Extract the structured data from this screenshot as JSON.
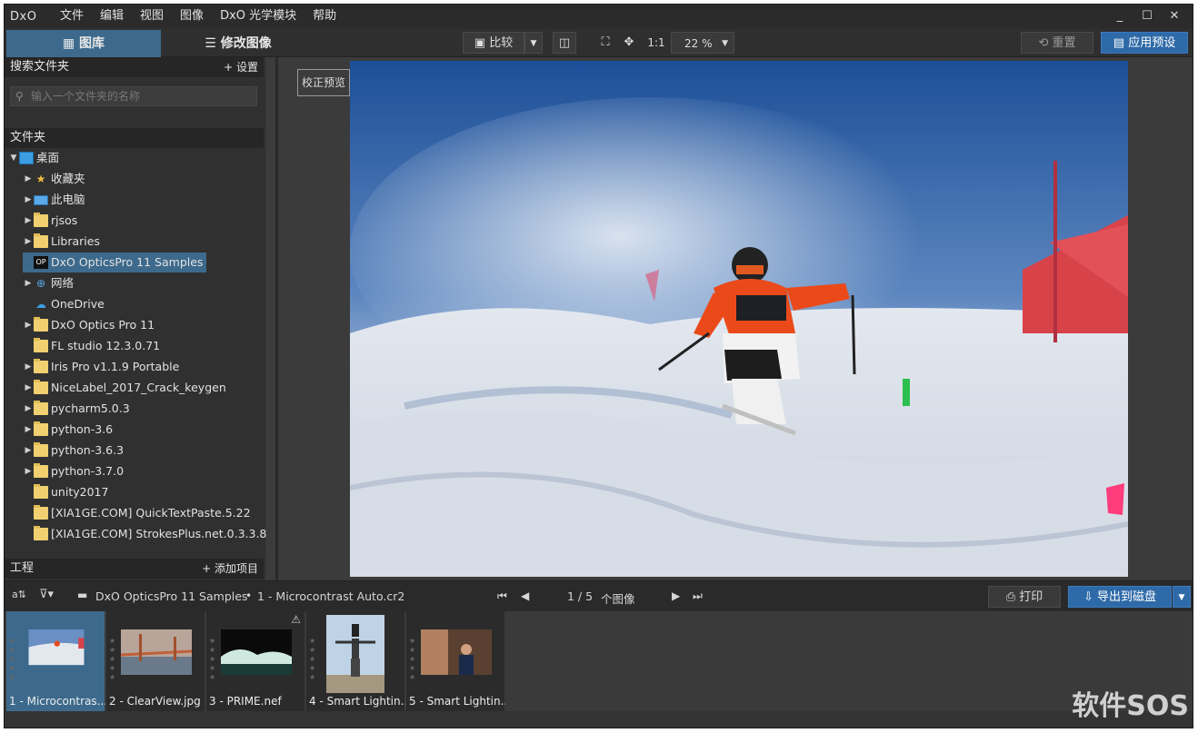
{
  "menubar": {
    "logo": "DxO",
    "items": [
      "文件",
      "编辑",
      "视图",
      "图像",
      "DxO 光学模块",
      "帮助"
    ],
    "minimize": "_",
    "maximize": "☐",
    "close": "✕"
  },
  "toolbar": {
    "tab_library": "图库",
    "tab_customize": "修改图像",
    "compare": "比较",
    "zoom_11": "1:1",
    "zoom_value": "22 %",
    "reset": "重置",
    "apply_preset": "应用预设"
  },
  "left": {
    "search_title": "搜索文件夹",
    "settings": "+ 设置",
    "search_placeholder": "输入一个文件夹的名称",
    "folders_title": "文件夹",
    "projects_title": "工程",
    "add_project": "+ 添加项目",
    "tree": [
      {
        "label": "桌面",
        "icon": "desktop-icon"
      },
      {
        "label": "收藏夹",
        "icon": "star-icon"
      },
      {
        "label": "此电脑",
        "icon": "pc-icon"
      },
      {
        "label": "rjsos",
        "icon": "folder-icon"
      },
      {
        "label": "Libraries",
        "icon": "folder-icon"
      },
      {
        "label": "DxO OpticsPro 11 Samples",
        "icon": "dxo-icon"
      },
      {
        "label": "网络",
        "icon": "network-icon"
      },
      {
        "label": "OneDrive",
        "icon": "cloud-icon"
      },
      {
        "label": "DxO Optics Pro 11",
        "icon": "folder-icon"
      },
      {
        "label": "FL studio 12.3.0.71",
        "icon": "folder-icon"
      },
      {
        "label": "Iris Pro v1.1.9 Portable",
        "icon": "folder-icon"
      },
      {
        "label": "NiceLabel_2017_Crack_keygen",
        "icon": "folder-icon"
      },
      {
        "label": "pycharm5.0.3",
        "icon": "folder-icon"
      },
      {
        "label": "python-3.6",
        "icon": "folder-icon"
      },
      {
        "label": "python-3.6.3",
        "icon": "folder-icon"
      },
      {
        "label": "python-3.7.0",
        "icon": "folder-icon"
      },
      {
        "label": "unity2017",
        "icon": "folder-icon"
      },
      {
        "label": "[XIA1GE.COM] QuickTextPaste.5.22",
        "icon": "folder-icon"
      },
      {
        "label": "[XIA1GE.COM] StrokesPlus.net.0.3.3.8",
        "icon": "folder-icon"
      }
    ]
  },
  "viewer": {
    "badge": "校正预览"
  },
  "filmbar": {
    "path_folder": "DxO OpticsPro 11 Samples",
    "path_sep": "•",
    "path_file": "1 - Microcontrast Auto.cr2",
    "page": "1 / 5",
    "count_label": "个图像",
    "print": "打印",
    "export": "导出到磁盘"
  },
  "thumbs": [
    {
      "caption": "1 - Microcontras..."
    },
    {
      "caption": "2 - ClearView.jpg"
    },
    {
      "caption": "3 - PRIME.nef"
    },
    {
      "caption": "4 - Smart Lightin..."
    },
    {
      "caption": "5 - Smart Lightin..."
    }
  ],
  "watermark": "软件SOS",
  "colors": {
    "accent": "#3d6a8c",
    "export_blue": "#2e6aa8"
  }
}
